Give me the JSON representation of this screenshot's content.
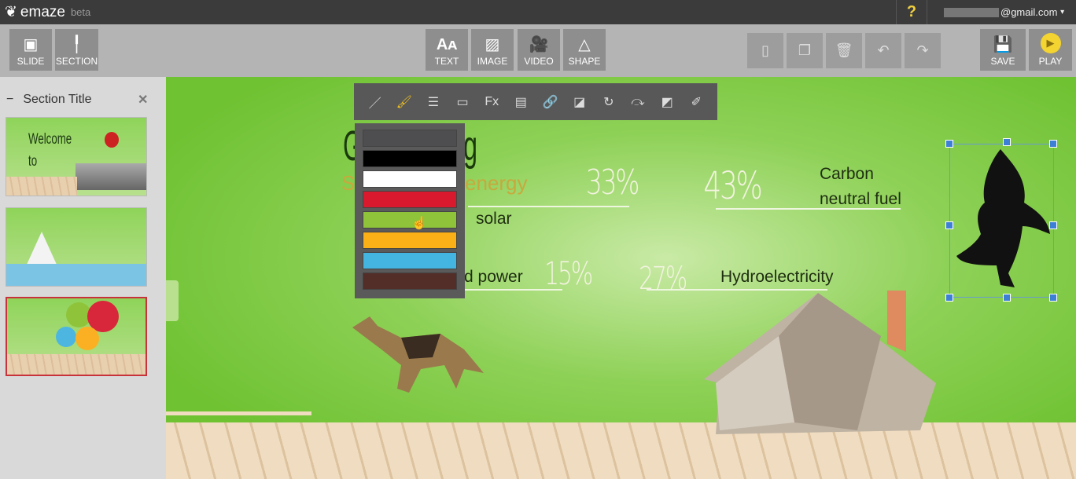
{
  "app": {
    "name": "emaze",
    "badge": "beta",
    "help": "?",
    "user_email": "@gmail.com",
    "user_caret": "▾"
  },
  "toolbar": {
    "left": [
      {
        "label": "SLIDE",
        "icon": "add-slide-icon",
        "glyph": "▣"
      },
      {
        "label": "SECTION",
        "icon": "add-section-icon",
        "glyph": "╿"
      }
    ],
    "insert": [
      {
        "label": "TEXT",
        "icon": "text-icon",
        "glyph": "Aᴀ"
      },
      {
        "label": "IMAGE",
        "icon": "image-icon",
        "glyph": "▨"
      },
      {
        "label": "VIDEO",
        "icon": "video-camera-icon",
        "glyph": "🎥"
      },
      {
        "label": "SHAPE",
        "icon": "shape-icon",
        "glyph": "△"
      }
    ],
    "actions": [
      {
        "icon": "new-page-icon",
        "glyph": "▯"
      },
      {
        "icon": "duplicate-icon",
        "glyph": "❐"
      },
      {
        "icon": "trash-icon",
        "glyph": "🗑"
      },
      {
        "icon": "undo-icon",
        "glyph": "↶"
      },
      {
        "icon": "redo-icon",
        "glyph": "↷"
      }
    ],
    "save": {
      "label": "SAVE",
      "icon": "save-icon",
      "glyph": "💾"
    },
    "play": {
      "label": "PLAY",
      "icon": "play-icon",
      "glyph": "▶"
    }
  },
  "sidebar": {
    "section_title": "Section Title",
    "collapse": "−",
    "close": "✕",
    "slides": [
      {
        "title": "Welcome to School"
      },
      {
        "title": ""
      },
      {
        "title": ""
      }
    ],
    "active_slide": 3
  },
  "format_toolbar": [
    {
      "icon": "brush-icon",
      "glyph": "／"
    },
    {
      "icon": "paint-roller-icon",
      "glyph": "🖌"
    },
    {
      "icon": "line-style-icon",
      "glyph": "☰"
    },
    {
      "icon": "border-icon",
      "glyph": "▭"
    },
    {
      "icon": "effects-icon",
      "glyph": "Fx"
    },
    {
      "icon": "gradient-icon",
      "glyph": "▤"
    },
    {
      "icon": "link-icon",
      "glyph": "🔗"
    },
    {
      "icon": "layer-order-icon",
      "glyph": "◪"
    },
    {
      "icon": "rotate-icon",
      "glyph": "↻"
    },
    {
      "icon": "flip-icon",
      "glyph": "⤼"
    },
    {
      "icon": "crop-icon",
      "glyph": "◩"
    },
    {
      "icon": "eraser-icon",
      "glyph": "✐"
    }
  ],
  "color_palette": {
    "colors": [
      "#4e4e50",
      "#000000",
      "#ffffff",
      "#d8192e",
      "#8fc43a",
      "#fcb018",
      "#44b4e0",
      "#532d28"
    ],
    "hovered": 4
  },
  "slide": {
    "title_visible_start": "G",
    "title_visible_end": "g",
    "subtitle_start": "S",
    "subtitle_end": "energy",
    "items": [
      {
        "value": "33%",
        "color": "#8fc43a",
        "label": "solar"
      },
      {
        "value": "43%",
        "color": "#d8263a",
        "label": "Carbon neutral fuel"
      },
      {
        "value": "15%",
        "color": "#4cb6e0",
        "label": "d power"
      },
      {
        "value": "27%",
        "color": "#fbb024",
        "label": "Hydroelectricity"
      }
    ]
  }
}
